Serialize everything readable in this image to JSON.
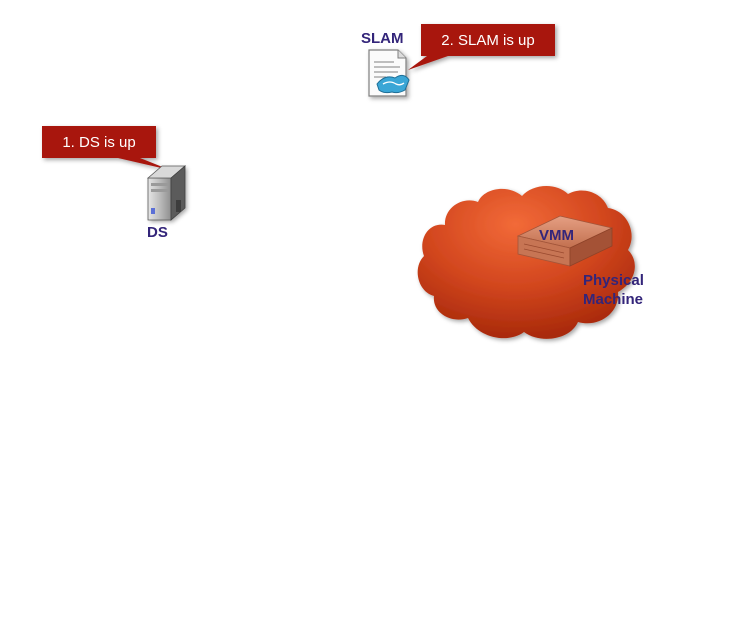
{
  "callouts": {
    "ds_up": "1. DS is up",
    "slam_up": "2. SLAM is up"
  },
  "nodes": {
    "slam": "SLAM",
    "ds": "DS",
    "vmm": "VMM",
    "physical_line1": "Physical",
    "physical_line2": "Machine"
  },
  "colors": {
    "callout_fill": "#a8140c",
    "label_text": "#33257a",
    "cloud_light": "#f06a3a",
    "cloud_dark": "#b83010"
  },
  "icons": {
    "slam": "document-handshake-icon",
    "ds": "server-tower-icon",
    "vmm": "rack-server-icon",
    "network": "cloud-icon"
  }
}
